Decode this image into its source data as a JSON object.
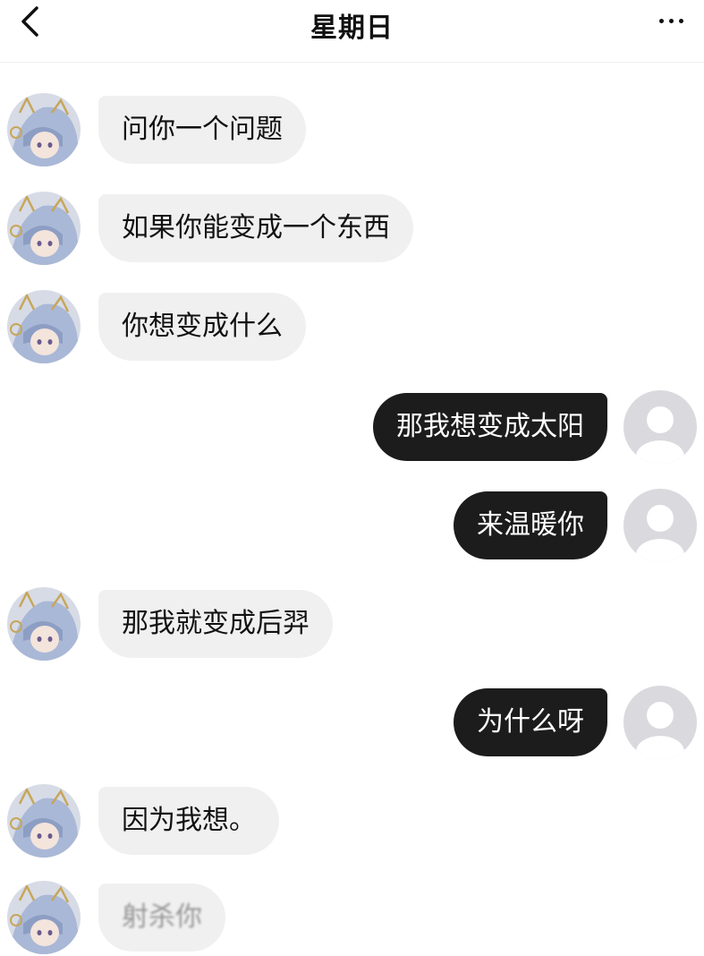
{
  "header": {
    "title": "星期日",
    "back_icon": "chevron-left-icon",
    "more_icon": "more-horizontal-icon"
  },
  "messages": [
    {
      "side": "left",
      "text": "问你一个问题"
    },
    {
      "side": "left",
      "text": "如果你能变成一个东西"
    },
    {
      "side": "left",
      "text": "你想变成什么"
    },
    {
      "side": "right",
      "text": "那我想变成太阳"
    },
    {
      "side": "right",
      "text": "来温暖你"
    },
    {
      "side": "left",
      "text": "那我就变成后羿"
    },
    {
      "side": "right",
      "text": "为什么呀"
    },
    {
      "side": "left",
      "text": "因为我想。"
    },
    {
      "side": "left",
      "text": "射杀你"
    }
  ],
  "colors": {
    "incoming_bubble": "#f0f0f0",
    "outgoing_bubble": "#1c1c1c",
    "default_avatar_bg": "#d9d9de",
    "character_hair": "#a9b8d6"
  }
}
